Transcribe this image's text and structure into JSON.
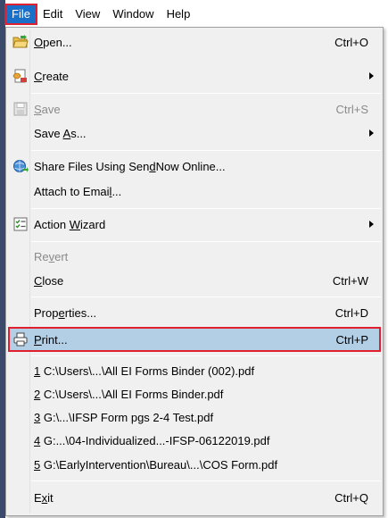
{
  "menubar": {
    "items": [
      "File",
      "Edit",
      "View",
      "Window",
      "Help"
    ],
    "active": "File"
  },
  "file_menu": {
    "open": {
      "pre": "",
      "key": "O",
      "post": "pen...",
      "shortcut": "Ctrl+O"
    },
    "create": {
      "pre": "",
      "key": "C",
      "post": "reate"
    },
    "save": {
      "pre": "",
      "key": "S",
      "post": "ave",
      "shortcut": "Ctrl+S"
    },
    "save_as": {
      "pre": "Save ",
      "key": "A",
      "post": "s..."
    },
    "share": {
      "pre": "Share Files Using Sen",
      "key": "d",
      "post": "Now Online..."
    },
    "attach": {
      "pre": "Attach to Emai",
      "key": "l",
      "post": "..."
    },
    "action_wizard": {
      "pre": "Action ",
      "key": "W",
      "post": "izard"
    },
    "revert": {
      "pre": "Re",
      "key": "v",
      "post": "ert"
    },
    "close": {
      "pre": "",
      "key": "C",
      "post": "lose",
      "shortcut": "Ctrl+W"
    },
    "properties": {
      "pre": "Prop",
      "key": "e",
      "post": "rties...",
      "shortcut": "Ctrl+D"
    },
    "print": {
      "pre": "",
      "key": "P",
      "post": "rint...",
      "shortcut": "Ctrl+P"
    },
    "recent": [
      {
        "num": "1",
        "path": " C:\\Users\\...\\All EI Forms Binder (002).pdf"
      },
      {
        "num": "2",
        "path": " C:\\Users\\...\\All EI Forms Binder.pdf"
      },
      {
        "num": "3",
        "path": " G:\\...\\IFSP Form pgs 2-4 Test.pdf"
      },
      {
        "num": "4",
        "path": " G:...\\04-Individualized...-IFSP-06122019.pdf"
      },
      {
        "num": "5",
        "path": " G:\\EarlyIntervention\\Bureau\\...\\COS Form.pdf"
      }
    ],
    "exit": {
      "pre": "E",
      "key": "x",
      "post": "it",
      "shortcut": "Ctrl+Q"
    }
  },
  "colors": {
    "menu_bg": "#f0f0f0",
    "active_menu_bg": "#1a6fc9",
    "highlight_bg": "#b3cfe6",
    "annotation_red": "#e0202e"
  },
  "icons": {
    "open": "folder-open-icon",
    "create": "create-pdf-icon",
    "save": "floppy-disk-icon",
    "share": "globe-share-icon",
    "action_wizard": "checklist-icon",
    "print": "printer-icon"
  }
}
